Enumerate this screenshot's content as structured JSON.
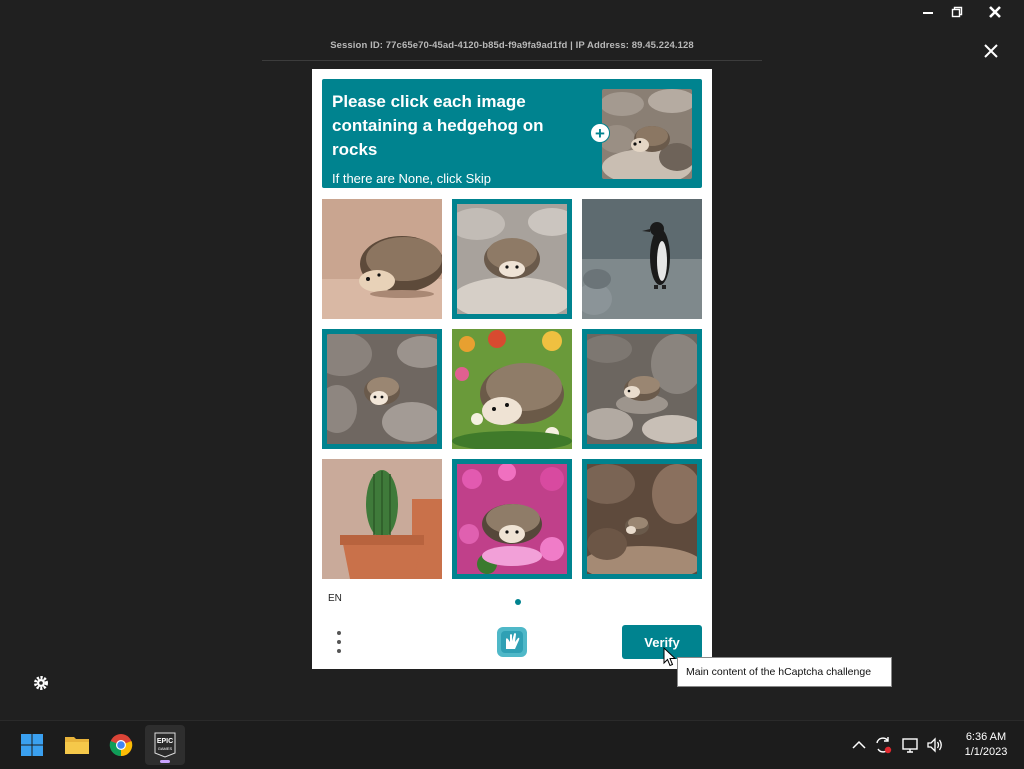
{
  "window": {
    "session_text": "Session ID: 77c65e70-45ad-4120-b85d-f9a9fa9ad1fd | IP Address: 89.45.224.128"
  },
  "captcha": {
    "prompt_title": "Please click each image containing a hedgehog on rocks",
    "prompt_subtitle": "If there are None, click Skip",
    "example_image": "hedgehog-on-rocks",
    "accent_color": "#00838f",
    "tiles": [
      {
        "subject": "hedgehog on sand",
        "selected": false
      },
      {
        "subject": "hedgehog on rocks",
        "selected": true
      },
      {
        "subject": "penguin on rocks",
        "selected": false
      },
      {
        "subject": "hedgehog on rocks",
        "selected": true
      },
      {
        "subject": "hedgehog in flowers",
        "selected": false
      },
      {
        "subject": "hedgehog on rocks",
        "selected": true
      },
      {
        "subject": "cactus in pot",
        "selected": false
      },
      {
        "subject": "hedgehog in pink flowers",
        "selected": true
      },
      {
        "subject": "hedgehog on rocks",
        "selected": true
      }
    ],
    "language": "EN",
    "verify_label": "Verify",
    "tooltip": "Main content of the hCaptcha challenge"
  },
  "taskbar": {
    "apps": [
      "start-icon",
      "file-explorer-icon",
      "chrome-icon",
      "epic-games-icon"
    ],
    "epic_label_top": "EPIC",
    "epic_label_bottom": "GAMES",
    "time": "6:36 AM",
    "date": "1/1/2023"
  }
}
